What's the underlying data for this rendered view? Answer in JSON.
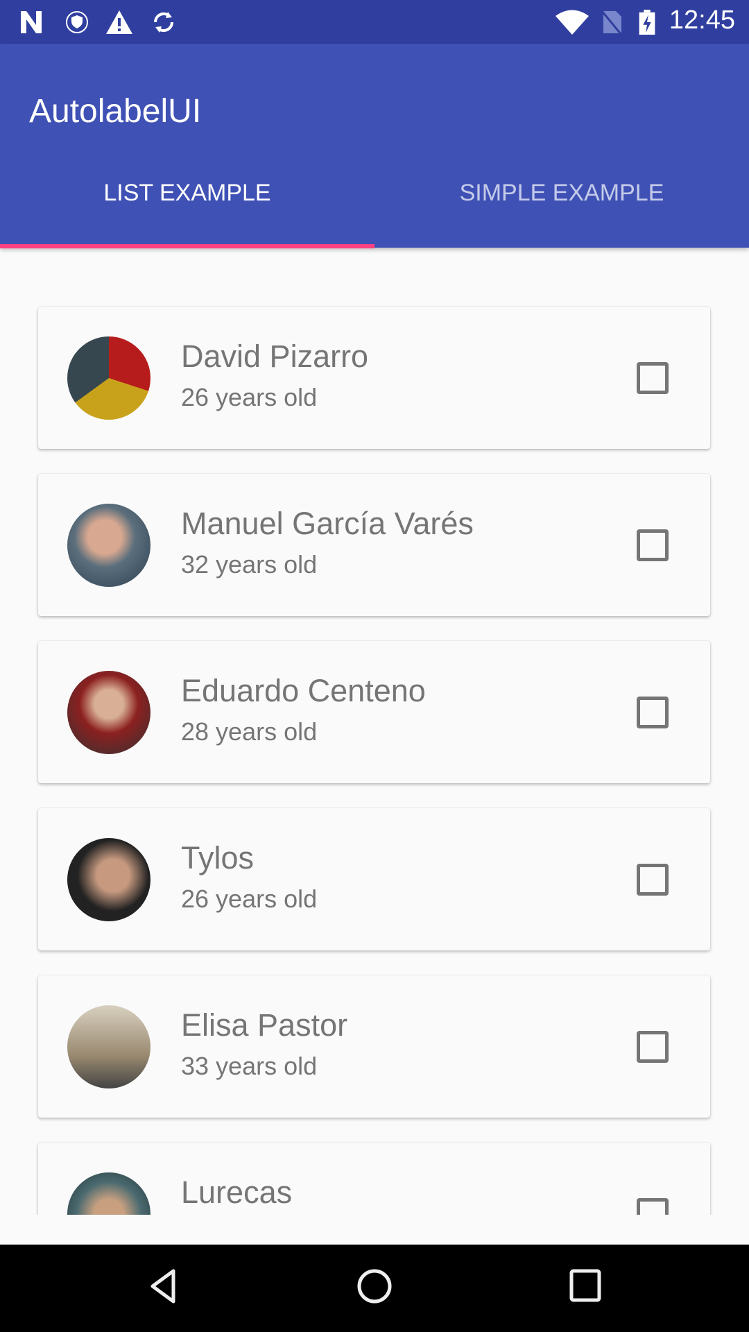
{
  "status_bar": {
    "time": "12:45",
    "icons": [
      "n-logo-icon",
      "vpn-shield-icon",
      "warning-icon",
      "sync-icon",
      "wifi-icon",
      "no-sim-icon",
      "battery-charging-icon"
    ]
  },
  "app_bar": {
    "title": "AutolabelUI"
  },
  "tabs": [
    {
      "label": "LIST EXAMPLE",
      "selected": true
    },
    {
      "label": "SIMPLE EXAMPLE",
      "selected": false
    }
  ],
  "colors": {
    "primary": "#3f51b5",
    "primary_dark": "#303f9f",
    "accent": "#ff4081"
  },
  "people": [
    {
      "name": "David Pizarro",
      "age": "26 years old",
      "checked": false
    },
    {
      "name": "Manuel García Varés",
      "age": "32 years old",
      "checked": false
    },
    {
      "name": "Eduardo Centeno",
      "age": "28 years old",
      "checked": false
    },
    {
      "name": "Tylos",
      "age": "26 years old",
      "checked": false
    },
    {
      "name": "Elisa Pastor",
      "age": "33 years old",
      "checked": false
    },
    {
      "name": "Lurecas",
      "age": "",
      "checked": false
    }
  ],
  "nav_bar": {
    "buttons": [
      "back-icon",
      "home-icon",
      "recents-icon"
    ]
  }
}
